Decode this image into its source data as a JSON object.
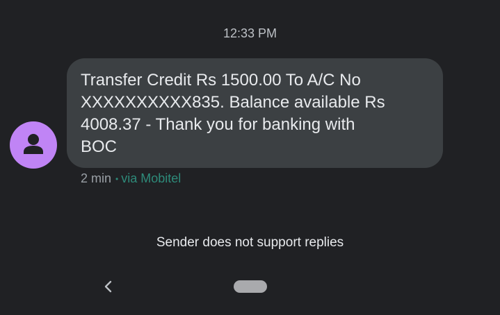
{
  "timestamp": "12:33 PM",
  "sender": {
    "avatar_icon": "person-icon",
    "avatar_color": "#c084f5"
  },
  "message": {
    "lines": [
      "Transfer Credit Rs 1500.00 To A/C No",
      "XXXXXXXXXX835. Balance available Rs",
      "4008.37 - Thank you for banking with",
      "BOC"
    ],
    "age": "2 min",
    "separator": "•",
    "via": "via Mobitel",
    "via_color": "#2e8b7a"
  },
  "notice": "Sender does not support replies",
  "nav": {
    "back_icon": "chevron-left-icon",
    "home_icon": "home-pill-icon"
  }
}
